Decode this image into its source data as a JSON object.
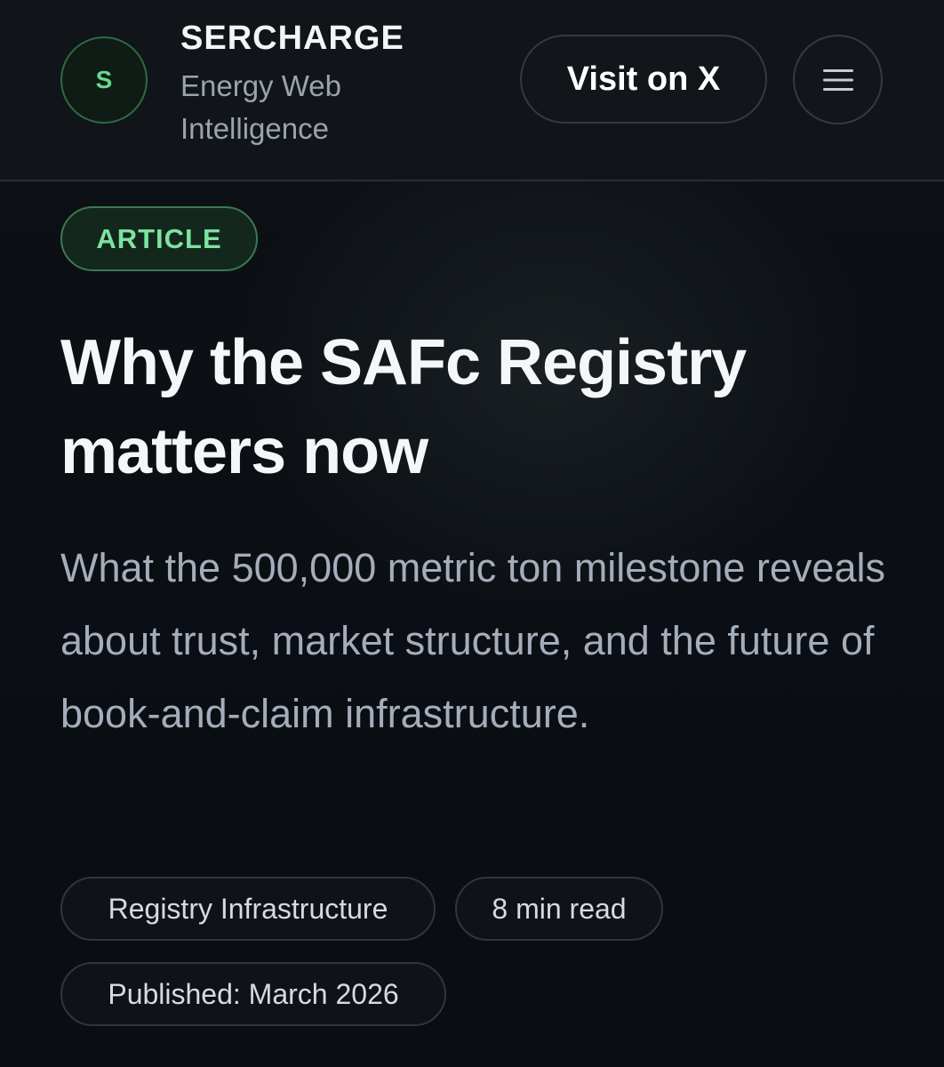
{
  "header": {
    "logo_letter": "S",
    "brand_name": "SERCHARGE",
    "brand_tagline": "Energy Web Intelligence",
    "visit_label": "Visit on X",
    "menu_icon": "hamburger-menu-icon"
  },
  "article": {
    "badge": "ARTICLE",
    "title": "Why the SAFc Registry matters now",
    "subtitle": "What the 500,000 metric ton milestone reveals about trust, market structure, and the future of book-and-claim infrastructure.",
    "tags": {
      "category": "Registry Infrastructure",
      "read_time": "8 min read",
      "published": "Published: March 2026"
    }
  },
  "colors": {
    "accent_green": "#66d88f",
    "background": "#0b0e13",
    "muted_text": "#a4adb9"
  }
}
